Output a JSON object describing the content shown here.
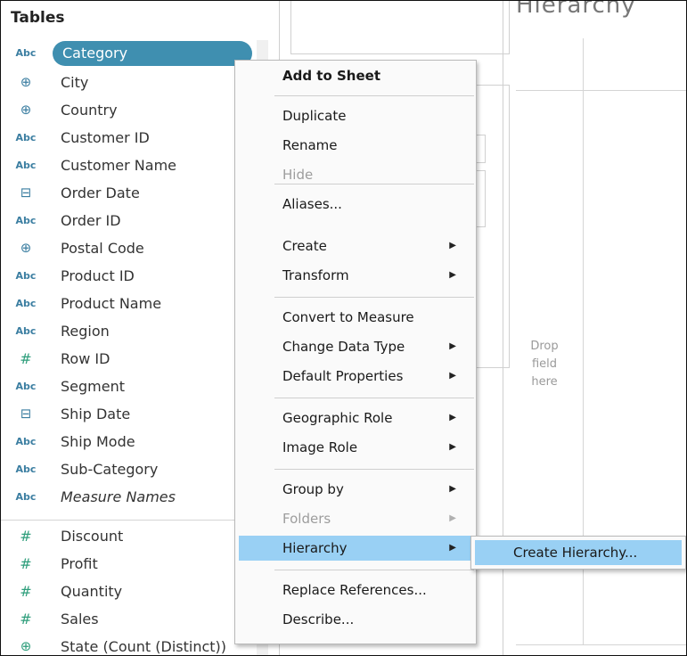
{
  "data_pane": {
    "title": "Tables",
    "fields": [
      {
        "icon": "abc",
        "label": "Category",
        "selected": true
      },
      {
        "icon": "globe",
        "label": "City"
      },
      {
        "icon": "globe",
        "label": "Country"
      },
      {
        "icon": "abc",
        "label": "Customer ID"
      },
      {
        "icon": "abc",
        "label": "Customer Name"
      },
      {
        "icon": "calendar",
        "label": "Order Date"
      },
      {
        "icon": "abc",
        "label": "Order ID"
      },
      {
        "icon": "globe",
        "label": "Postal Code"
      },
      {
        "icon": "abc",
        "label": "Product ID"
      },
      {
        "icon": "abc",
        "label": "Product Name"
      },
      {
        "icon": "abc",
        "label": "Region"
      },
      {
        "icon": "hash",
        "label": "Row ID"
      },
      {
        "icon": "abc",
        "label": "Segment"
      },
      {
        "icon": "calendar",
        "label": "Ship Date"
      },
      {
        "icon": "abc",
        "label": "Ship Mode"
      },
      {
        "icon": "abc",
        "label": "Sub-Category"
      },
      {
        "icon": "abc",
        "label": "Measure Names",
        "italic": true
      },
      {
        "icon": "hash",
        "label": "Discount"
      },
      {
        "icon": "hash",
        "label": "Profit"
      },
      {
        "icon": "hash",
        "label": "Quantity"
      },
      {
        "icon": "hash",
        "label": "Sales"
      },
      {
        "icon": "globe-green",
        "label": "State (Count (Distinct))"
      }
    ],
    "abc_glyph": "Abc",
    "hash_glyph": "#",
    "globe_glyph": "⊕",
    "calendar_glyph": "⊟"
  },
  "view": {
    "title": "Hierarchy",
    "drop_hint": "Drop field here"
  },
  "context_menu": {
    "items": [
      {
        "label": "Add to Sheet",
        "bold": true
      },
      {
        "label": "Duplicate"
      },
      {
        "label": "Rename"
      },
      {
        "label": "Hide",
        "disabled": true
      },
      {
        "label": "Aliases..."
      },
      {
        "label": "Create",
        "submenu": true
      },
      {
        "label": "Transform",
        "submenu": true
      },
      {
        "label": "Convert to Measure"
      },
      {
        "label": "Change Data Type",
        "submenu": true
      },
      {
        "label": "Default Properties",
        "submenu": true
      },
      {
        "label": "Geographic Role",
        "submenu": true
      },
      {
        "label": "Image Role",
        "submenu": true
      },
      {
        "label": "Group by",
        "submenu": true
      },
      {
        "label": "Folders",
        "submenu": true,
        "disabled": true
      },
      {
        "label": "Hierarchy",
        "submenu": true,
        "highlighted": true
      },
      {
        "label": "Replace References..."
      },
      {
        "label": "Describe..."
      }
    ],
    "arrow_glyph": "▶"
  },
  "submenu": {
    "items": [
      {
        "label": "Create Hierarchy...",
        "highlighted": true
      }
    ]
  },
  "colors": {
    "selected_pill": "#3f8fb0",
    "menu_highlight": "#99d0f4",
    "dimension_icon": "#3b7ea1",
    "measure_icon": "#2e9e7b"
  }
}
